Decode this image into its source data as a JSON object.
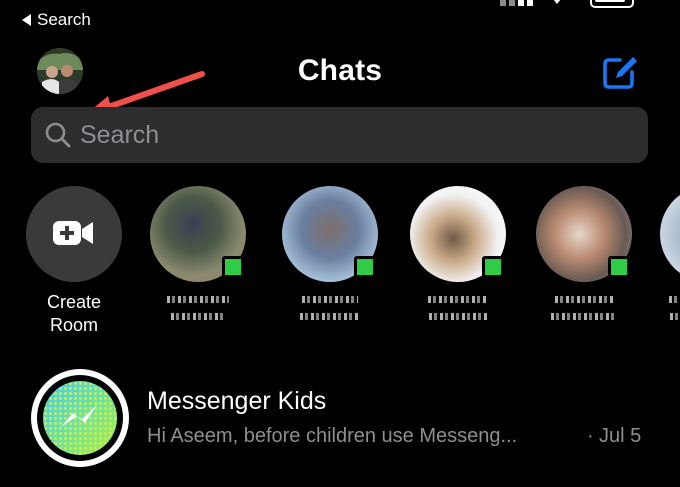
{
  "status_bar": {
    "back_label": "Search"
  },
  "header": {
    "title": "Chats"
  },
  "search": {
    "placeholder": "Search"
  },
  "stories": {
    "create_room": {
      "line1": "Create",
      "line2": "Room"
    }
  },
  "chats": [
    {
      "name": "Messenger Kids",
      "preview": "Hi Aseem, before children use Messeng...",
      "separator": "·",
      "date": "Jul 5"
    }
  ],
  "colors": {
    "accent": "#1877f2",
    "annotation": "#f0504a",
    "online": "#31cc46",
    "search_bg": "#2d2d2f",
    "secondary_text": "#8e8e93"
  },
  "icons": {
    "back": "back-triangle-icon",
    "compose": "compose-icon",
    "search": "search-icon",
    "create_room": "video-camera-plus-icon",
    "messenger_kids": "messenger-bolt-icon"
  }
}
